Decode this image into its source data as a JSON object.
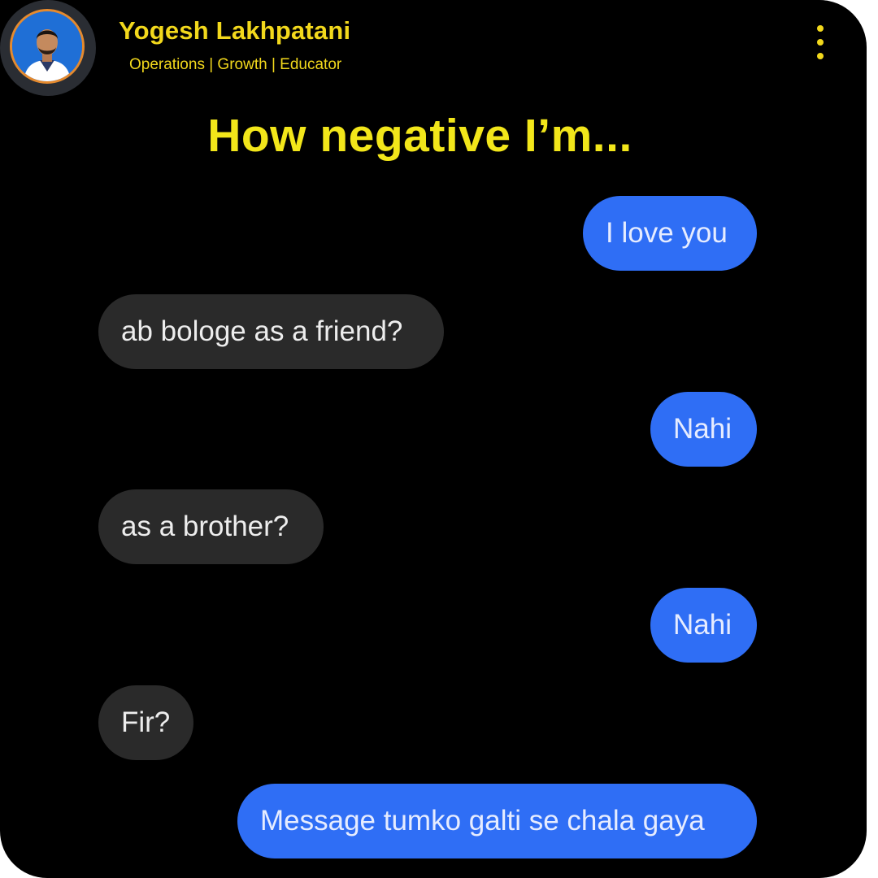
{
  "author": {
    "name": "Yogesh Lakhpatani",
    "tagline": "Operations | Growth | Educator"
  },
  "headline": "How negative I’m...",
  "messages": [
    {
      "side": "sent",
      "text": "I love you"
    },
    {
      "side": "received",
      "text": "ab bologe as a friend?"
    },
    {
      "side": "sent",
      "text": "Nahi"
    },
    {
      "side": "received",
      "text": "as a brother?"
    },
    {
      "side": "sent",
      "text": "Nahi"
    },
    {
      "side": "received",
      "text": "Fir?"
    },
    {
      "side": "sent",
      "text": "Message tumko galti se chala gaya"
    }
  ],
  "icons": {
    "more": "more-vertical-icon",
    "avatar": "profile-photo"
  },
  "colors": {
    "background": "#000000",
    "accent_yellow": "#f2d81c",
    "sent_bubble": "#2f6ef5",
    "received_bubble": "#2a2a2a"
  }
}
